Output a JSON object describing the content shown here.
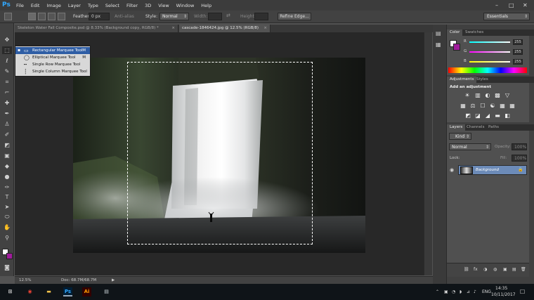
{
  "app": {
    "logo": "Ps",
    "menus": [
      "File",
      "Edit",
      "Image",
      "Layer",
      "Type",
      "Select",
      "Filter",
      "3D",
      "View",
      "Window",
      "Help"
    ],
    "window_controls": [
      "–",
      "□",
      "✕"
    ]
  },
  "options_bar": {
    "feather_label": "Feather:",
    "feather_value": "0 px",
    "antialias_label": "Anti-alias",
    "style_label": "Style:",
    "style_value": "Normal",
    "width_label": "Width:",
    "height_label": "Height:",
    "refine_label": "Refine Edge...",
    "workspace_value": "Essentials"
  },
  "documents": {
    "tabs": [
      {
        "label": "Skeleton Water Fall Composite.psd @ 8.33% (Background copy, RGB/8) *",
        "active": false
      },
      {
        "label": "cascade-1846424.jpg @ 12.5% (RGB/8)",
        "active": true
      }
    ],
    "close_glyph": "×"
  },
  "marquee_flyout": {
    "items": [
      {
        "label": "Rectangular Marquee Tool",
        "key": "M",
        "icon": "▭",
        "selected": true
      },
      {
        "label": "Elliptical Marquee Tool",
        "key": "M",
        "icon": "◯",
        "selected": false
      },
      {
        "label": "Single Row Marquee Tool",
        "key": "",
        "icon": "┅",
        "selected": false
      },
      {
        "label": "Single Column Marquee Tool",
        "key": "",
        "icon": "┆",
        "selected": false
      }
    ],
    "bullet": "▪"
  },
  "status_bar": {
    "zoom": "12.5%",
    "doc_info": "Doc: 68.7M/68.7M",
    "arrow": "▶"
  },
  "color_panel": {
    "tabs": [
      "Color",
      "Swatches"
    ],
    "channels": [
      {
        "name": "R",
        "value": "255"
      },
      {
        "name": "G",
        "value": "255"
      },
      {
        "name": "B",
        "value": "255"
      }
    ],
    "fg_color": "#ffffff",
    "bg_color": "#a01c9c"
  },
  "adjustments_panel": {
    "tabs": [
      "Adjustments",
      "Styles"
    ],
    "heading": "Add an adjustment",
    "row1": [
      "☀",
      "▥",
      "◐",
      "▩",
      "▽"
    ],
    "row2": [
      "▦",
      "⚖",
      "☐",
      "☯",
      "▦",
      "▦"
    ],
    "row3": [
      "◩",
      "◪",
      "◢",
      "▬",
      "◧"
    ]
  },
  "layers_panel": {
    "tabs": [
      "Layers",
      "Channels",
      "Paths"
    ],
    "kind_label": "Kind",
    "blend_mode": "Normal",
    "opacity_label": "Opacity:",
    "opacity_value": "100%",
    "lock_label": "Lock:",
    "fill_label": "Fill:",
    "fill_value": "100%",
    "layer_name": "Background",
    "bottom_icons": [
      "⛓",
      "fx",
      "◑",
      "◍",
      "▣",
      "▤",
      "🗑"
    ]
  },
  "taskbar": {
    "apps": [
      {
        "label": "⊞",
        "color": "#ffffff"
      },
      {
        "label": "◉",
        "color": "#e94235"
      },
      {
        "label": "▬",
        "color": "#f1c24c"
      },
      {
        "label": "Ps",
        "color": "#31a8ff"
      },
      {
        "label": "Ai",
        "color": "#ff9a00"
      },
      {
        "label": "▤",
        "color": "#cfd8dc"
      }
    ],
    "lang": "ENG",
    "time": "14:35",
    "date": "10/11/2017",
    "tray_icons": [
      "⌃",
      "▣",
      "◔",
      "◗",
      "⊿",
      "♪"
    ],
    "notif": "☐"
  }
}
